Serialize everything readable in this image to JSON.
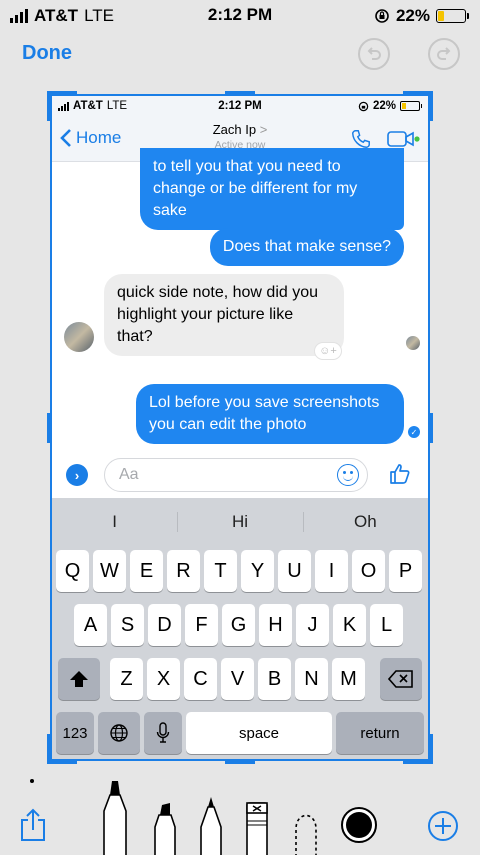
{
  "status": {
    "carrier": "AT&T",
    "network": "LTE",
    "time": "2:12 PM",
    "battery": "22%",
    "battery_level": 0.22
  },
  "markup": {
    "done_label": "Done"
  },
  "inner": {
    "status": {
      "carrier": "AT&T",
      "network": "LTE",
      "time": "2:12 PM",
      "battery": "22%"
    },
    "header": {
      "back_label": "Home",
      "contact_name": "Zach Ip",
      "contact_chevron": ">",
      "presence": "Active now"
    },
    "messages": [
      {
        "from": "me",
        "text": "to tell you that you need to change or be different for my sake"
      },
      {
        "from": "me",
        "text": "Does that make sense?"
      },
      {
        "from": "them",
        "text": "quick side note, how did you highlight your picture like that?"
      },
      {
        "from": "me",
        "text": "Lol before you save screenshots you can edit the photo"
      }
    ],
    "composer": {
      "placeholder": "Aa"
    },
    "keyboard": {
      "suggestions": [
        "I",
        "Hi",
        "Oh"
      ],
      "row1": [
        "Q",
        "W",
        "E",
        "R",
        "T",
        "Y",
        "U",
        "I",
        "O",
        "P"
      ],
      "row2": [
        "A",
        "S",
        "D",
        "F",
        "G",
        "H",
        "J",
        "K",
        "L"
      ],
      "row3": [
        "Z",
        "X",
        "C",
        "V",
        "B",
        "N",
        "M"
      ],
      "numbers_label": "123",
      "space_label": "space",
      "return_label": "return"
    }
  },
  "colors": {
    "accent": "#1a7ee6",
    "bubble_me": "#1f86f0",
    "bubble_them": "#ededed",
    "keyboard_bg": "#d1d4d9"
  }
}
